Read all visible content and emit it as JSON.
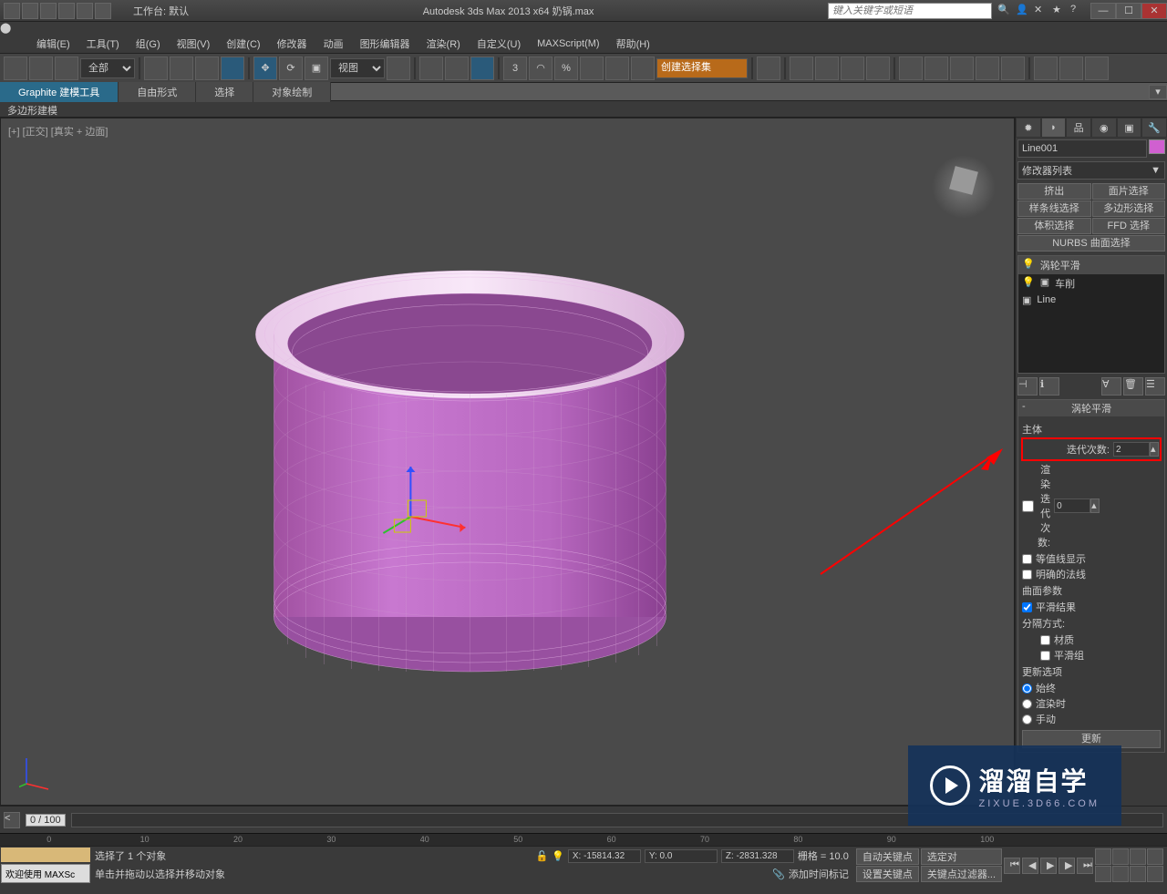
{
  "titlebar": {
    "workspace_label": "工作台: 默认",
    "app_title": "Autodesk 3ds Max  2013 x64    奶锅.max",
    "search_placeholder": "键入关键字或短语"
  },
  "menubar": {
    "items": [
      "编辑(E)",
      "工具(T)",
      "组(G)",
      "视图(V)",
      "创建(C)",
      "修改器",
      "动画",
      "图形编辑器",
      "渲染(R)",
      "自定义(U)",
      "MAXScript(M)",
      "帮助(H)"
    ]
  },
  "toolbar": {
    "filter_all": "全部",
    "view_select": "视图",
    "named_sel_label": "创建选择集"
  },
  "ribbon": {
    "tabs": [
      "Graphite 建模工具",
      "自由形式",
      "选择",
      "对象绘制"
    ],
    "sub": "多边形建模"
  },
  "viewport": {
    "label": "[+] [正交] [真实 + 边面]"
  },
  "cmdpanel": {
    "object_name": "Line001",
    "modlist_label": "修改器列表",
    "mod_buttons": [
      "挤出",
      "面片选择",
      "样条线选择",
      "多边形选择",
      "体积选择",
      "FFD 选择"
    ],
    "nurbs_btn": "NURBS 曲面选择",
    "stack": [
      "涡轮平滑",
      "车削",
      "Line"
    ],
    "rollout_title": "涡轮平滑",
    "main_label": "主体",
    "iterations_label": "迭代次数:",
    "iterations_value": "2",
    "render_iters_label": "渲染迭代次数:",
    "render_iters_value": "0",
    "isoline_label": "等值线显示",
    "explicit_normals_label": "明确的法线",
    "surface_params": "曲面参数",
    "smooth_result": "平滑结果",
    "separate_by": "分隔方式:",
    "material": "材质",
    "smooth_group": "平滑组",
    "update_options": "更新选项",
    "always": "始终",
    "render": "渲染时",
    "manual": "手动",
    "update_btn": "更新"
  },
  "timeline": {
    "frame_display": "0 / 100"
  },
  "statusbar": {
    "welcome": "欢迎使用  MAXSc",
    "selected": "选择了 1 个对象",
    "hint": "单击并拖动以选择并移动对象",
    "x": "X: -15814.32",
    "y": "Y: 0.0",
    "z": "Z: -2831.328",
    "grid": "栅格 = 10.0",
    "add_time_tag": "添加时间标记",
    "autokey": "自动关键点",
    "setkey": "设置关键点",
    "selected_obj": "选定对",
    "keyfilter": "关键点过滤器..."
  },
  "watermark": {
    "title": "溜溜自学",
    "url": "ZIXUE.3D66.COM"
  }
}
